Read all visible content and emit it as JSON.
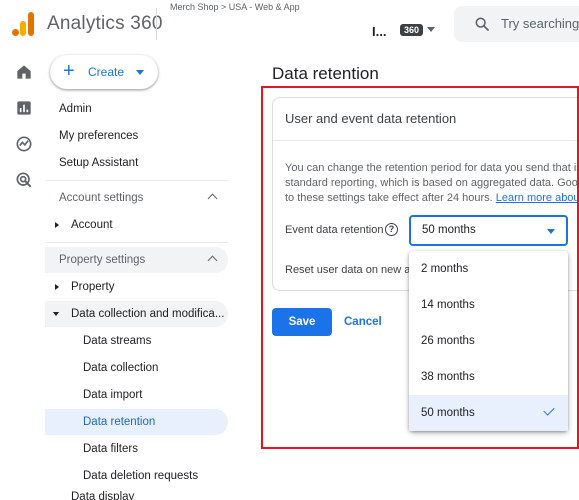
{
  "topbar": {
    "app_name": "Analytics 360",
    "breadcrumb": "Merch Shop > USA - Web & App",
    "account_name": "I...",
    "account_badge": "360",
    "search_placeholder": "Try searching"
  },
  "rail": {
    "items": [
      {
        "icon": "home-icon"
      },
      {
        "icon": "reports-icon"
      },
      {
        "icon": "explore-icon"
      },
      {
        "icon": "advertising-icon"
      }
    ]
  },
  "sidebar": {
    "create_label": "Create",
    "admin": "Admin",
    "my_preferences": "My preferences",
    "setup_assistant": "Setup Assistant",
    "account_settings": "Account settings",
    "account": "Account",
    "property_settings": "Property settings",
    "property": "Property",
    "data_collection_mod": "Data collection and modifica...",
    "data_streams": "Data streams",
    "data_collection": "Data collection",
    "data_import": "Data import",
    "data_retention": "Data retention",
    "data_filters": "Data filters",
    "data_deletion": "Data deletion requests",
    "cut_off_item": "Data display"
  },
  "main": {
    "title": "Data retention",
    "card_title": "User and event data retention",
    "desc_line1": "You can change the retention period for data you send that is",
    "desc_line2": "standard reporting, which is based on aggregated data. Googl",
    "desc_line3": "to these settings take effect after 24 hours.",
    "learn_more": "Learn more about",
    "event_retention_label": "Event data retention",
    "event_retention_value": "50 months",
    "reset_label": "Reset user data on new ac",
    "save": "Save",
    "cancel": "Cancel"
  },
  "dropdown": {
    "options": [
      "2 months",
      "14 months",
      "26 months",
      "38 months",
      "50 months"
    ],
    "selected": "50 months"
  },
  "colors": {
    "accent": "#1a73e8",
    "highlight": "#e8131b",
    "selected_bg": "#e8f0fe"
  }
}
